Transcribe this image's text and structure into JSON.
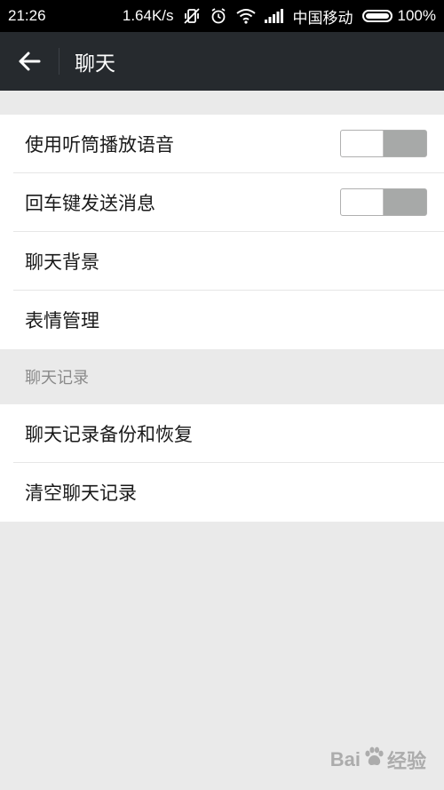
{
  "status_bar": {
    "time": "21:26",
    "network_speed": "1.64K/s",
    "carrier": "中国移动",
    "battery": "100%"
  },
  "header": {
    "back_icon": "arrow-left-icon",
    "title": "聊天"
  },
  "settings_group_1": {
    "items": [
      {
        "label": "使用听筒播放语音",
        "toggle": "off"
      },
      {
        "label": "回车键发送消息",
        "toggle": "off"
      },
      {
        "label": "聊天背景"
      },
      {
        "label": "表情管理"
      }
    ]
  },
  "chat_history_section": {
    "header": "聊天记录",
    "items": [
      {
        "label": "聊天记录备份和恢复"
      },
      {
        "label": "清空聊天记录"
      }
    ]
  },
  "watermark": {
    "text_left": "Bai",
    "text_right": "经验"
  },
  "colors": {
    "status_bar": "#000000",
    "app_bar": "#262a2e",
    "background": "#eaeaea",
    "toggle_off": "#a7a9a8"
  }
}
